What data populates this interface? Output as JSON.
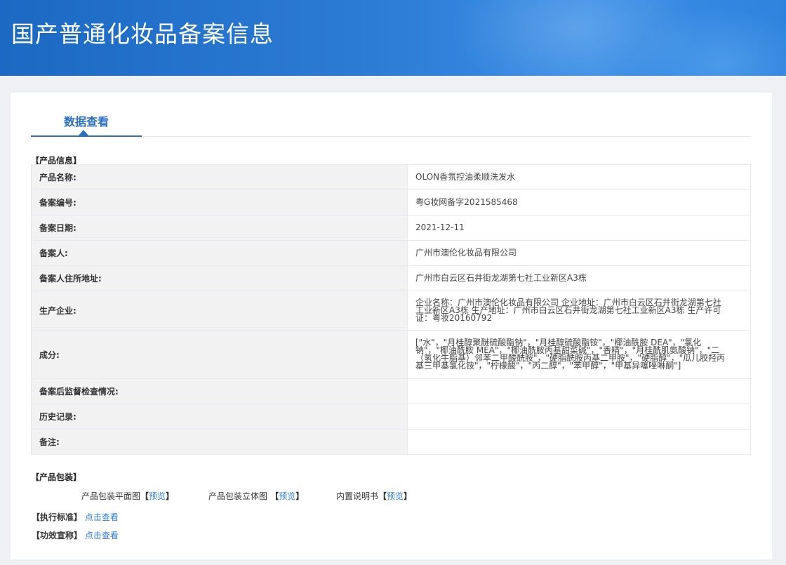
{
  "header": {
    "title": "国产普通化妆品备案信息"
  },
  "tabs": [
    {
      "label": "数据查看"
    }
  ],
  "product_section": {
    "label": "【产品信息】",
    "rows": [
      {
        "key": "产品名称:",
        "value": "OLON香氛控油柔顺洗发水"
      },
      {
        "key": "备案编号:",
        "value": "粤G妆网备字2021585468"
      },
      {
        "key": "备案日期:",
        "value": "2021-12-11"
      },
      {
        "key": "备案人:",
        "value": "广州市澳伦化妆品有限公司"
      },
      {
        "key": "备案人住所地址:",
        "value": "广州市白云区石井街龙湖第七社工业新区A3栋"
      },
      {
        "key": "生产企业:",
        "value": "企业名称：广州市澳伦化妆品有限公司 企业地址：广州市白云区石井街龙湖第七社工业新区A3栋 生产地址：广州市白云区石井街龙湖第七社工业新区A3栋 生产许可证：粤妆20160792"
      },
      {
        "key": "成分:",
        "value": "[\"水\"，\"月桂醇聚醚硫酸酯钠\"，\"月桂醇硫酸酯铵\"，\"椰油酰胺 DEA\"，\"氯化钠\"，\"椰油酰胺 MEA\"，\"椰油酰胺丙基甜菜碱\"，\"香精\"，\"月桂酰肌氨酸钠\"，\"二（氢化牛脂基）邻苯二甲酸酰胺\"，\"硬脂酰胺丙基二甲胺\"，\"硬脂醇\"，\"瓜儿胶羟丙基三甲基氯化铵\"，\"柠檬酸\"，\"丙二醇\"，\"苯甲醇\"，\"甲基异噻唑啉酮\"]"
      },
      {
        "key": "备案后监督检查情况:",
        "value": ""
      },
      {
        "key": "历史记录:",
        "value": ""
      },
      {
        "key": "备注:",
        "value": ""
      }
    ]
  },
  "packaging": {
    "label": "【产品包装】",
    "items": [
      {
        "label": "产品包装平面图",
        "open": "【",
        "link": "预览",
        "close": "】"
      },
      {
        "label": "产品包装立体图",
        "open": " 【",
        "link": "预览",
        "close": "】"
      },
      {
        "label": "内置说明书",
        "open": "【",
        "link": "预览",
        "close": "】"
      }
    ]
  },
  "standard": {
    "label": "【执行标准】",
    "link": "点击查看"
  },
  "efficacy": {
    "label": "【功效宣称】",
    "link": "点击查看"
  },
  "colors": {
    "banner": "#1b69c2",
    "accent": "#2c6fc2",
    "link": "#2f7ed8",
    "row_key_bg": "#f2f2f2"
  }
}
